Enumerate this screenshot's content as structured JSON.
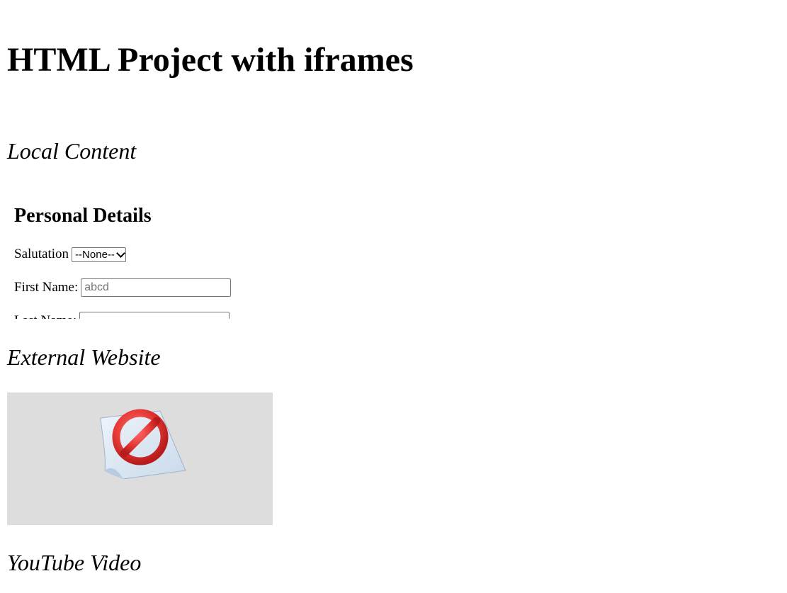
{
  "page": {
    "title": "HTML Project with iframes"
  },
  "sections": {
    "local": {
      "heading": "Local Content"
    },
    "external": {
      "heading": "External Website",
      "blocked_icon": "blocked-page-icon"
    },
    "youtube": {
      "heading": "YouTube Video"
    }
  },
  "local_frame": {
    "form_title": "Personal Details",
    "salutation": {
      "label": "Salutation",
      "selected": "--None--"
    },
    "first_name": {
      "label": "First Name:",
      "value": "",
      "placeholder": "abcd"
    },
    "last_name": {
      "label": "Last Name:",
      "value": ""
    }
  },
  "colors": {
    "blocked_frame_bg": "#dddddd",
    "blocked_sign_red": "#e53935",
    "blocked_paper": "#dbe7f3"
  }
}
